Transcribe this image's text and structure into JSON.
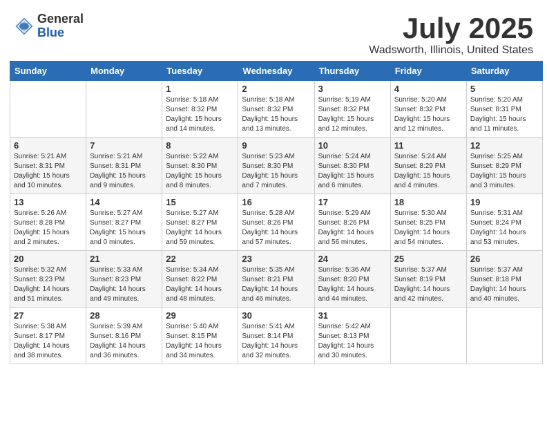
{
  "logo": {
    "general": "General",
    "blue": "Blue"
  },
  "title": "July 2025",
  "subtitle": "Wadsworth, Illinois, United States",
  "weekdays": [
    "Sunday",
    "Monday",
    "Tuesday",
    "Wednesday",
    "Thursday",
    "Friday",
    "Saturday"
  ],
  "weeks": [
    [
      {
        "day": "",
        "sunrise": "",
        "sunset": "",
        "daylight": ""
      },
      {
        "day": "",
        "sunrise": "",
        "sunset": "",
        "daylight": ""
      },
      {
        "day": "1",
        "sunrise": "Sunrise: 5:18 AM",
        "sunset": "Sunset: 8:32 PM",
        "daylight": "Daylight: 15 hours and 14 minutes."
      },
      {
        "day": "2",
        "sunrise": "Sunrise: 5:18 AM",
        "sunset": "Sunset: 8:32 PM",
        "daylight": "Daylight: 15 hours and 13 minutes."
      },
      {
        "day": "3",
        "sunrise": "Sunrise: 5:19 AM",
        "sunset": "Sunset: 8:32 PM",
        "daylight": "Daylight: 15 hours and 12 minutes."
      },
      {
        "day": "4",
        "sunrise": "Sunrise: 5:20 AM",
        "sunset": "Sunset: 8:32 PM",
        "daylight": "Daylight: 15 hours and 12 minutes."
      },
      {
        "day": "5",
        "sunrise": "Sunrise: 5:20 AM",
        "sunset": "Sunset: 8:31 PM",
        "daylight": "Daylight: 15 hours and 11 minutes."
      }
    ],
    [
      {
        "day": "6",
        "sunrise": "Sunrise: 5:21 AM",
        "sunset": "Sunset: 8:31 PM",
        "daylight": "Daylight: 15 hours and 10 minutes."
      },
      {
        "day": "7",
        "sunrise": "Sunrise: 5:21 AM",
        "sunset": "Sunset: 8:31 PM",
        "daylight": "Daylight: 15 hours and 9 minutes."
      },
      {
        "day": "8",
        "sunrise": "Sunrise: 5:22 AM",
        "sunset": "Sunset: 8:30 PM",
        "daylight": "Daylight: 15 hours and 8 minutes."
      },
      {
        "day": "9",
        "sunrise": "Sunrise: 5:23 AM",
        "sunset": "Sunset: 8:30 PM",
        "daylight": "Daylight: 15 hours and 7 minutes."
      },
      {
        "day": "10",
        "sunrise": "Sunrise: 5:24 AM",
        "sunset": "Sunset: 8:30 PM",
        "daylight": "Daylight: 15 hours and 6 minutes."
      },
      {
        "day": "11",
        "sunrise": "Sunrise: 5:24 AM",
        "sunset": "Sunset: 8:29 PM",
        "daylight": "Daylight: 15 hours and 4 minutes."
      },
      {
        "day": "12",
        "sunrise": "Sunrise: 5:25 AM",
        "sunset": "Sunset: 8:29 PM",
        "daylight": "Daylight: 15 hours and 3 minutes."
      }
    ],
    [
      {
        "day": "13",
        "sunrise": "Sunrise: 5:26 AM",
        "sunset": "Sunset: 8:28 PM",
        "daylight": "Daylight: 15 hours and 2 minutes."
      },
      {
        "day": "14",
        "sunrise": "Sunrise: 5:27 AM",
        "sunset": "Sunset: 8:27 PM",
        "daylight": "Daylight: 15 hours and 0 minutes."
      },
      {
        "day": "15",
        "sunrise": "Sunrise: 5:27 AM",
        "sunset": "Sunset: 8:27 PM",
        "daylight": "Daylight: 14 hours and 59 minutes."
      },
      {
        "day": "16",
        "sunrise": "Sunrise: 5:28 AM",
        "sunset": "Sunset: 8:26 PM",
        "daylight": "Daylight: 14 hours and 57 minutes."
      },
      {
        "day": "17",
        "sunrise": "Sunrise: 5:29 AM",
        "sunset": "Sunset: 8:26 PM",
        "daylight": "Daylight: 14 hours and 56 minutes."
      },
      {
        "day": "18",
        "sunrise": "Sunrise: 5:30 AM",
        "sunset": "Sunset: 8:25 PM",
        "daylight": "Daylight: 14 hours and 54 minutes."
      },
      {
        "day": "19",
        "sunrise": "Sunrise: 5:31 AM",
        "sunset": "Sunset: 8:24 PM",
        "daylight": "Daylight: 14 hours and 53 minutes."
      }
    ],
    [
      {
        "day": "20",
        "sunrise": "Sunrise: 5:32 AM",
        "sunset": "Sunset: 8:23 PM",
        "daylight": "Daylight: 14 hours and 51 minutes."
      },
      {
        "day": "21",
        "sunrise": "Sunrise: 5:33 AM",
        "sunset": "Sunset: 8:23 PM",
        "daylight": "Daylight: 14 hours and 49 minutes."
      },
      {
        "day": "22",
        "sunrise": "Sunrise: 5:34 AM",
        "sunset": "Sunset: 8:22 PM",
        "daylight": "Daylight: 14 hours and 48 minutes."
      },
      {
        "day": "23",
        "sunrise": "Sunrise: 5:35 AM",
        "sunset": "Sunset: 8:21 PM",
        "daylight": "Daylight: 14 hours and 46 minutes."
      },
      {
        "day": "24",
        "sunrise": "Sunrise: 5:36 AM",
        "sunset": "Sunset: 8:20 PM",
        "daylight": "Daylight: 14 hours and 44 minutes."
      },
      {
        "day": "25",
        "sunrise": "Sunrise: 5:37 AM",
        "sunset": "Sunset: 8:19 PM",
        "daylight": "Daylight: 14 hours and 42 minutes."
      },
      {
        "day": "26",
        "sunrise": "Sunrise: 5:37 AM",
        "sunset": "Sunset: 8:18 PM",
        "daylight": "Daylight: 14 hours and 40 minutes."
      }
    ],
    [
      {
        "day": "27",
        "sunrise": "Sunrise: 5:38 AM",
        "sunset": "Sunset: 8:17 PM",
        "daylight": "Daylight: 14 hours and 38 minutes."
      },
      {
        "day": "28",
        "sunrise": "Sunrise: 5:39 AM",
        "sunset": "Sunset: 8:16 PM",
        "daylight": "Daylight: 14 hours and 36 minutes."
      },
      {
        "day": "29",
        "sunrise": "Sunrise: 5:40 AM",
        "sunset": "Sunset: 8:15 PM",
        "daylight": "Daylight: 14 hours and 34 minutes."
      },
      {
        "day": "30",
        "sunrise": "Sunrise: 5:41 AM",
        "sunset": "Sunset: 8:14 PM",
        "daylight": "Daylight: 14 hours and 32 minutes."
      },
      {
        "day": "31",
        "sunrise": "Sunrise: 5:42 AM",
        "sunset": "Sunset: 8:13 PM",
        "daylight": "Daylight: 14 hours and 30 minutes."
      },
      {
        "day": "",
        "sunrise": "",
        "sunset": "",
        "daylight": ""
      },
      {
        "day": "",
        "sunrise": "",
        "sunset": "",
        "daylight": ""
      }
    ]
  ]
}
